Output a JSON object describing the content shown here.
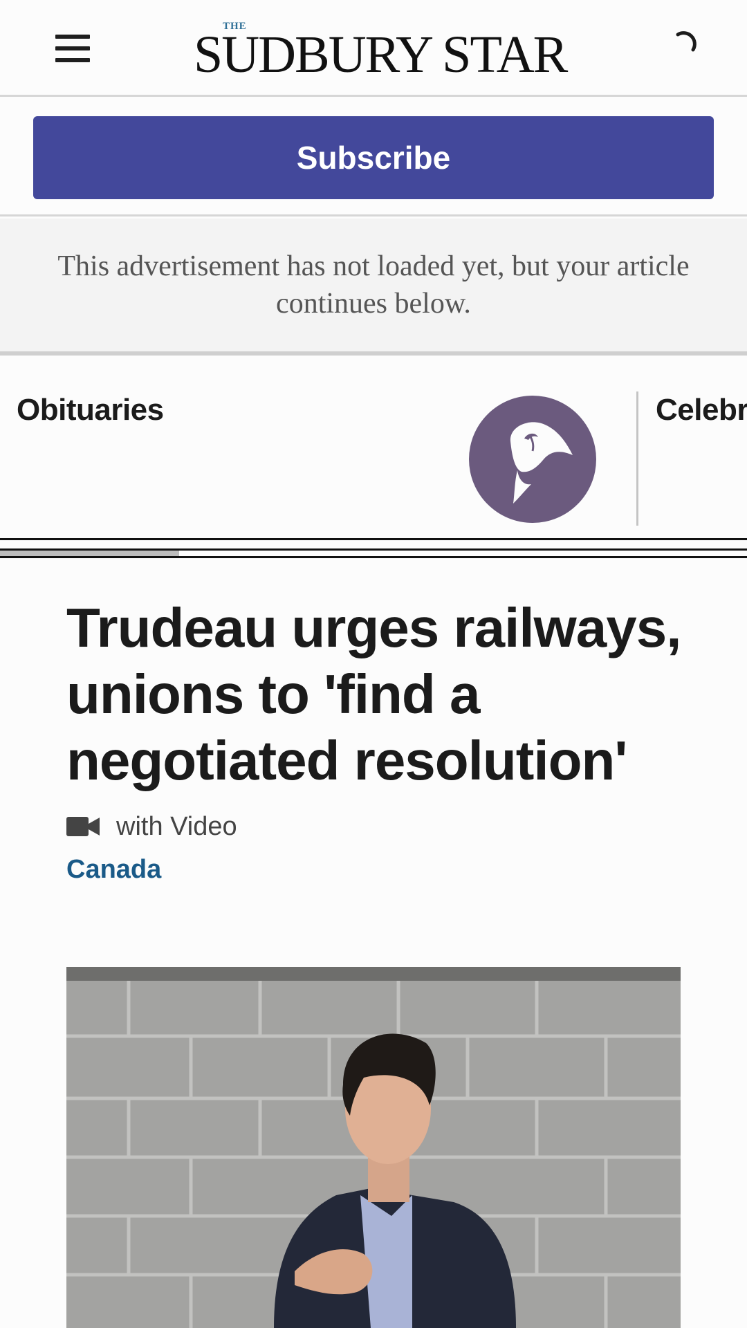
{
  "header": {
    "logo_small": "THE",
    "logo_name": "SUDBURY STAR",
    "menu_icon": "hamburger-menu-icon",
    "spinner_icon": "loading-spinner-icon"
  },
  "subscribe": {
    "label": "Subscribe",
    "color": "#43489b"
  },
  "ad": {
    "message": "This advertisement has not loaded yet, but your article continues below."
  },
  "carousel": {
    "items": [
      {
        "label": "Obituaries",
        "icon": "calla-lily-icon",
        "icon_color": "#6b5a7e"
      },
      {
        "label": "Celebrations"
      }
    ],
    "scroll_progress": 0.24
  },
  "article": {
    "headline": "Trudeau urges railways, unions to 'find a negotiated resolution'",
    "media_label": "with Video",
    "media_icon": "video-camera-icon",
    "category": "Canada",
    "category_color": "#1a5a88"
  }
}
